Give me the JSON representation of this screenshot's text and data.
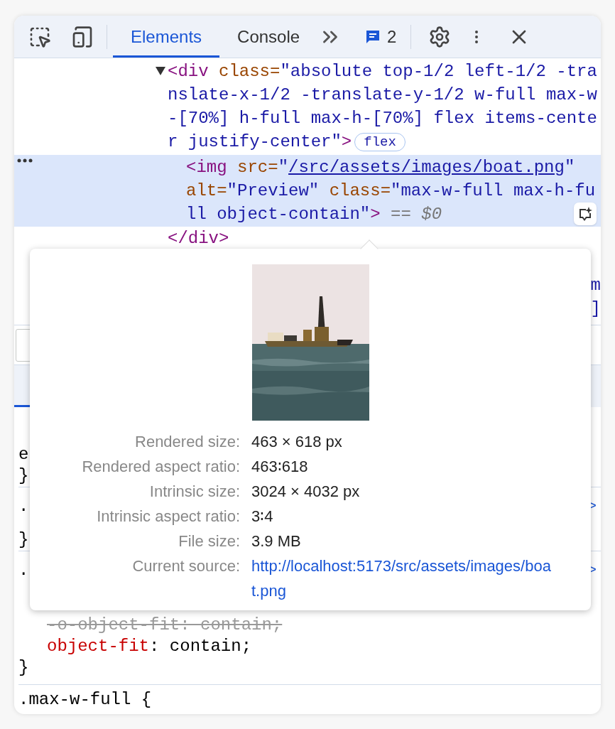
{
  "toolbar": {
    "tabs": [
      {
        "label": "Elements",
        "selected": true
      },
      {
        "label": "Console",
        "selected": false
      }
    ],
    "issues_count": "2"
  },
  "dom_tree": {
    "expanded": true,
    "lines": [
      [
        {
          "kind": "tag",
          "text": "<div"
        },
        {
          "kind": "attr",
          "text": " class="
        },
        {
          "kind": "value",
          "text": "\"absolute top-1/2 left-1/2 -tra"
        }
      ],
      [
        {
          "kind": "value",
          "text": "nslate-x-1/2 -translate-y-1/2 w-full max-w"
        }
      ],
      [
        {
          "kind": "value",
          "text": "-[70%] h-full max-h-[70%] flex items-cente"
        }
      ],
      [
        {
          "kind": "value",
          "text": "r justify-center\""
        },
        {
          "kind": "tag",
          "text": ">"
        },
        {
          "kind": "badge",
          "text": "flex"
        }
      ]
    ],
    "children": [
      {
        "selected": true,
        "lines": [
          [
            {
              "kind": "tag",
              "text": "<img"
            },
            {
              "kind": "attr",
              "text": " src="
            },
            {
              "kind": "value",
              "text": "\""
            },
            {
              "kind": "link",
              "text": "/src/assets/images/boat.png"
            },
            {
              "kind": "value",
              "text": "\""
            }
          ],
          [
            {
              "kind": "attr",
              "text": "alt="
            },
            {
              "kind": "value",
              "text": "\"Preview\""
            },
            {
              "kind": "attr",
              "text": " class="
            },
            {
              "kind": "value",
              "text": "\"max-w-full max-h-fu"
            }
          ],
          [
            {
              "kind": "value",
              "text": "ll object-contain\""
            },
            {
              "kind": "tag",
              "text": ">"
            },
            {
              "kind": "hint",
              "text": " == "
            },
            {
              "kind": "var",
              "text": "$0"
            }
          ]
        ]
      }
    ],
    "closing": "</div>",
    "partly_hidden": [
      "m",
      "]"
    ]
  },
  "styles": {
    "partly_hidden": [
      {
        "kind": "left",
        "text": "e"
      },
      {
        "kind": "left",
        "text": "}"
      },
      {
        "kind": "rule",
        "text": ".",
        "link": ">"
      },
      {
        "kind": "left",
        "text": "}"
      },
      {
        "kind": "rule",
        "text": ".",
        "link": ">"
      }
    ],
    "declarations": [
      {
        "kind": "overridden",
        "text": "-o-object-fit: contain;"
      },
      {
        "kind": "active",
        "property": "object-fit",
        "separator": ":",
        "value": "contain;"
      }
    ],
    "closing": "}",
    "next_selector": ".max-w-full {"
  },
  "image_popover": {
    "rows": [
      {
        "label": "Rendered size:",
        "value": "463 × 618 px"
      },
      {
        "label": "Rendered aspect ratio:",
        "value": "463∶618"
      },
      {
        "label": "Intrinsic size:",
        "value": "3024 × 4032 px"
      },
      {
        "label": "Intrinsic aspect ratio:",
        "value": "3∶4"
      },
      {
        "label": "File size:",
        "value": "3.9 MB"
      },
      {
        "label": "Current source:",
        "value": "http://localhost:5173/src/assets/images/boat.png",
        "kind": "link"
      }
    ]
  }
}
